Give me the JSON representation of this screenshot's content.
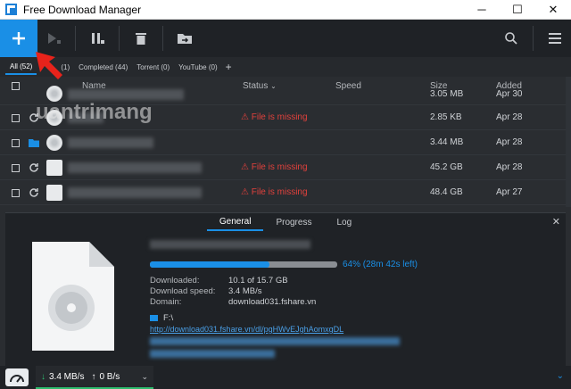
{
  "window": {
    "title": "Free Download Manager",
    "minimize": "─",
    "maximize": "☐",
    "close": "✕"
  },
  "tabs": [
    {
      "label": "All (52)",
      "active": true
    },
    {
      "label": "(1)",
      "active": false
    },
    {
      "label": "Completed (44)",
      "active": false
    },
    {
      "label": "Torrent (0)",
      "active": false
    },
    {
      "label": "YouTube (0)",
      "active": false
    }
  ],
  "tab_add": "+",
  "columns": {
    "name": "Name",
    "status": "Status",
    "speed": "Speed",
    "size": "Size",
    "added": "Added"
  },
  "rows": [
    {
      "status": "",
      "size": "3.05 MB",
      "added": "Apr 30"
    },
    {
      "status": "File is missing",
      "size": "2.85 KB",
      "added": "Apr 28"
    },
    {
      "status": "",
      "size": "3.44 MB",
      "added": "Apr 28"
    },
    {
      "status": "File is missing",
      "size": "45.2 GB",
      "added": "Apr 28"
    },
    {
      "status": "File is missing",
      "size": "48.4 GB",
      "added": "Apr 27"
    }
  ],
  "detail": {
    "tabs": [
      "General",
      "Progress",
      "Log"
    ],
    "progress_percent": 64,
    "progress_text": "64% (28m 42s left)",
    "downloaded_label": "Downloaded:",
    "downloaded_value": "10.1 of 15.7 GB",
    "speed_label": "Download speed:",
    "speed_value": "3.4 MB/s",
    "domain_label": "Domain:",
    "domain_value": "download031.fshare.vn",
    "folder": "F:\\",
    "link": "http://download031.fshare.vn/dl/pgHWvEJghAomxgDL"
  },
  "statusbar": {
    "down": "3.4 MB/s",
    "up": "0 B/s"
  },
  "watermark": "uantrimang",
  "colors": {
    "accent": "#1a8fe6",
    "error": "#e0413c",
    "success": "#2dbd6e"
  }
}
